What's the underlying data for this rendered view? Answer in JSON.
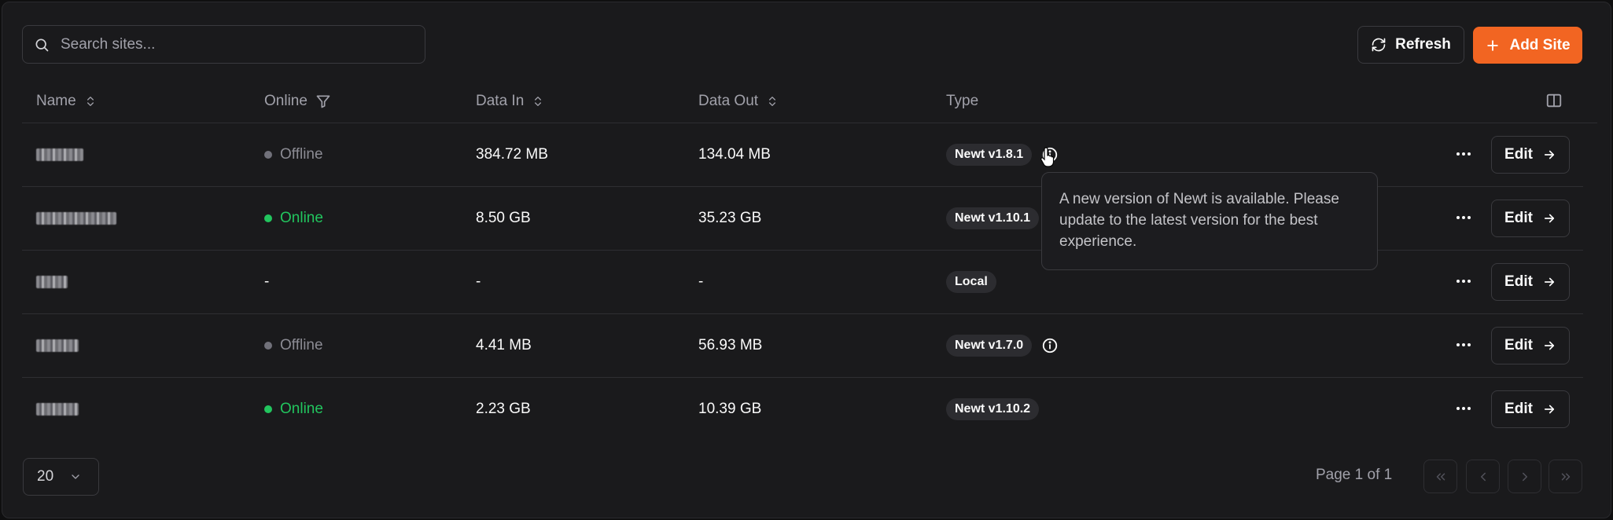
{
  "search": {
    "placeholder": "Search sites..."
  },
  "toolbar": {
    "refresh_label": "Refresh",
    "add_label": "Add Site"
  },
  "columns": {
    "name": "Name",
    "online": "Online",
    "data_in": "Data In",
    "data_out": "Data Out",
    "type": "Type"
  },
  "rows": [
    {
      "status": "Offline",
      "data_in": "384.72 MB",
      "data_out": "134.04 MB",
      "type": "Newt v1.8.1",
      "edit": "Edit"
    },
    {
      "status": "Online",
      "data_in": "8.50 GB",
      "data_out": "35.23 GB",
      "type": "Newt v1.10.1",
      "edit": "Edit"
    },
    {
      "status": "-",
      "data_in": "-",
      "data_out": "-",
      "type": "Local",
      "edit": "Edit"
    },
    {
      "status": "Offline",
      "data_in": "4.41 MB",
      "data_out": "56.93 MB",
      "type": "Newt v1.7.0",
      "edit": "Edit"
    },
    {
      "status": "Online",
      "data_in": "2.23 GB",
      "data_out": "10.39 GB",
      "type": "Newt v1.10.2",
      "edit": "Edit"
    }
  ],
  "tooltip": {
    "text": "A new version of Newt is available. Please update to the latest version for the best experience."
  },
  "footer": {
    "page_size": "20",
    "page_info": "Page 1 of 1"
  },
  "colors": {
    "accent": "#f26522",
    "online": "#22c55e",
    "offline": "#71717a"
  }
}
